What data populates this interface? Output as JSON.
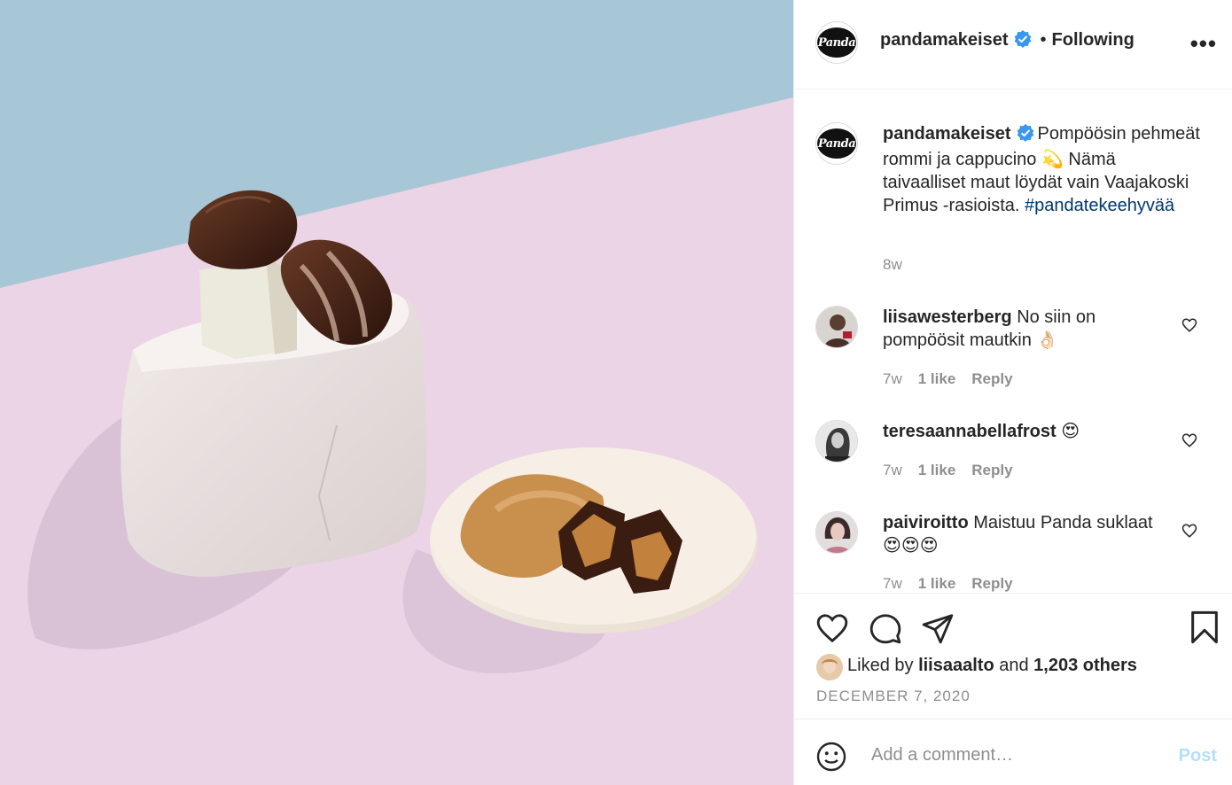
{
  "post": {
    "username": "pandamakeiset",
    "follow_separator": "•",
    "follow_status": "Following",
    "more_label": "•••",
    "avatar_text": "Panda"
  },
  "caption": {
    "username": "pandamakeiset",
    "text": "Pompöösin pehmeät rommi ja cappucino 💫 Nämä taivaalliset maut löydät vain Vaajakoski Primus -rasioista. ",
    "hashtag": "#pandatekeehyvää",
    "age": "8w"
  },
  "comments": [
    {
      "username": "liisawesterberg",
      "text": "No siin on pompöösit mautkin 👌🏻",
      "age": "7w",
      "likes": "1 like",
      "reply": "Reply"
    },
    {
      "username": "teresaannabellafrost",
      "text": "😍",
      "age": "7w",
      "likes": "1 like",
      "reply": "Reply"
    },
    {
      "username": "paiviroitto",
      "text": "Maistuu Panda suklaat 😍😍😍",
      "age": "7w",
      "likes": "1 like",
      "reply": "Reply"
    }
  ],
  "likes": {
    "prefix": "Liked by",
    "user": "liisaaalto",
    "middle": "and",
    "others": "1,203 others"
  },
  "date": "DECEMBER 7, 2020",
  "add_comment": {
    "placeholder": "Add a comment…",
    "post_label": "Post"
  },
  "colors": {
    "link": "#00376b",
    "verified": "#3897f0",
    "muted": "#8e8e8e",
    "post_disabled": "#b2dffc"
  }
}
